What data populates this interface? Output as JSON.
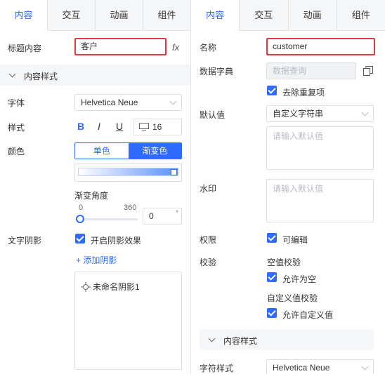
{
  "left": {
    "tabs": [
      "内容",
      "交互",
      "动画",
      "组件"
    ],
    "title_label": "标题内容",
    "title_value": "客户",
    "fx_label": "fx",
    "section_title": "内容样式",
    "font_label": "字体",
    "font_value": "Helvetica Neue",
    "style_label": "样式",
    "bold": "B",
    "italic": "I",
    "underline": "U",
    "font_size": "16",
    "color_label": "颜色",
    "color_solid": "单色",
    "color_gradient": "渐变色",
    "angle_label": "渐变角度",
    "angle_min": "0",
    "angle_max": "360",
    "angle_value": "0",
    "degree_symbol": "°",
    "shadow_label": "文字阴影",
    "shadow_enable": "开启阴影效果",
    "add_shadow": "+ 添加阴影",
    "shadow_item": "未命名阴影1"
  },
  "right": {
    "tabs": [
      "内容",
      "交互",
      "动画",
      "组件"
    ],
    "name_label": "名称",
    "name_value": "customer",
    "dict_label": "数据字典",
    "dict_placeholder": "数据查询",
    "dedupe": "去除重复项",
    "default_label": "默认值",
    "default_select": "自定义字符串",
    "default_placeholder": "请输入默认值",
    "watermark_label": "水印",
    "watermark_placeholder": "请输入默认值",
    "permission_label": "权限",
    "editable": "可编辑",
    "validation_label": "校验",
    "empty_validation": "空值校验",
    "allow_empty": "允许为空",
    "custom_validation": "自定义值校验",
    "allow_custom": "允许自定义值",
    "section_title": "内容样式",
    "char_style_label": "字符样式",
    "char_font": "Helvetica Neue"
  },
  "colors": {
    "accent": "#2f6bff",
    "highlight_border": "#e23a3a"
  }
}
